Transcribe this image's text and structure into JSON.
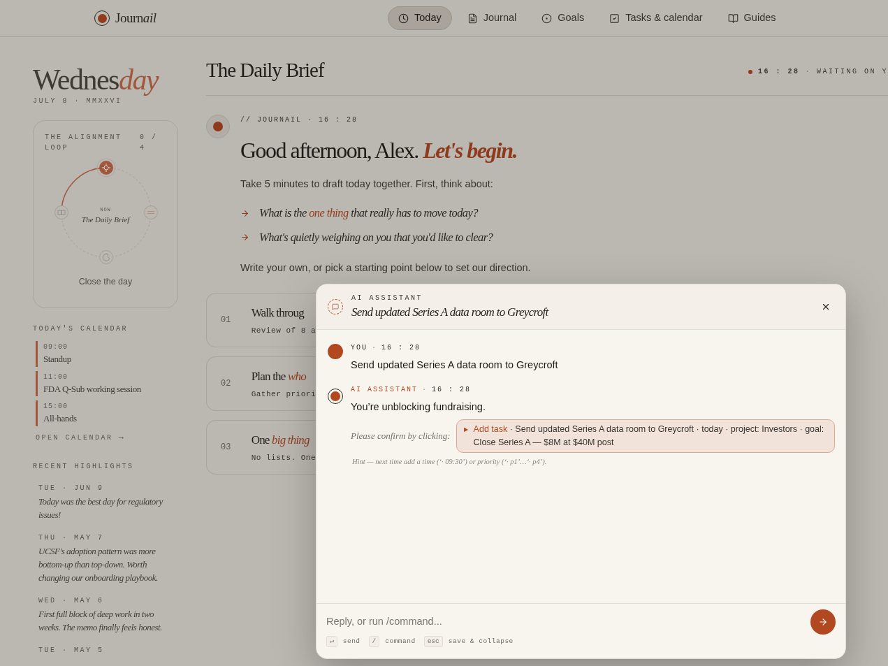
{
  "brand": {
    "name": [
      {
        "text": "Journ",
        "accent": false
      },
      {
        "text": "ail",
        "accent": true
      }
    ]
  },
  "nav": [
    {
      "label": "Today",
      "selected": true
    },
    {
      "label": "Journal",
      "selected": false
    },
    {
      "label": "Goals",
      "selected": false
    },
    {
      "label": "Tasks & calendar",
      "selected": false
    },
    {
      "label": "Guides",
      "selected": false
    }
  ],
  "sidebar": {
    "day": [
      {
        "text": "Wednes",
        "accent": false
      },
      {
        "text": "day",
        "accent": true
      }
    ],
    "date": "JULY 8 · MMXXVI",
    "loop": {
      "title": "THE ALIGNMENT LOOP",
      "count": "0 / 4",
      "level": 0.25,
      "now_label": "NOW",
      "now_step": "The Daily Brief",
      "next": "Close the day"
    },
    "calendar_heading": "TODAY'S CALENDAR",
    "calendar": [
      {
        "time": "09:00",
        "title": "Standup"
      },
      {
        "time": "11:00",
        "title": "FDA Q-Sub working session"
      },
      {
        "time": "15:00",
        "title": "All-hands"
      }
    ],
    "calendar_link": "OPEN CALENDAR ⟶",
    "highlights_heading": "RECENT HIGHLIGHTS",
    "highlights": [
      {
        "date": "TUE · JUN 9",
        "text": "Today was the best day for regulatory issues!"
      },
      {
        "date": "THU · MAY 7",
        "text": "UCSF's adoption pattern was more bottom-up than top-down. Worth changing our onboarding playbook."
      },
      {
        "date": "WED · MAY 6",
        "text": "First full block of deep work in two weeks. The memo finally feels honest."
      },
      {
        "date": "TUE · MAY 5"
      }
    ]
  },
  "main": {
    "title": "The Daily Brief",
    "status": {
      "time": "16 : 28",
      "sep": "·",
      "text": "WAITING ON Y"
    },
    "meta": "// JOURNAIL · 16 : 28",
    "greeting": [
      {
        "text": "Good afternoon, Alex. ",
        "accent": false
      },
      {
        "text": "Let's begin.",
        "accent": true
      }
    ],
    "intro": "Take 5 minutes to draft today together. First, think about:",
    "prompts": [
      [
        {
          "text": "What is the ",
          "accent": false
        },
        {
          "text": "one thing",
          "accent": true
        },
        {
          "text": " that really has to move today?",
          "accent": false
        }
      ],
      [
        {
          "text": "What's quietly weighing on you that you'd like to clear?",
          "accent": false
        }
      ]
    ],
    "outro": "Write your own, or pick a starting point below to set our direction.",
    "starters": [
      {
        "number": "01",
        "title": [
          {
            "text": "Walk throug",
            "accent": false
          }
        ],
        "subtitle": "Review of 8 a"
      },
      {
        "number": "02",
        "title": [
          {
            "text": "Plan the ",
            "accent": false
          },
          {
            "text": "who",
            "accent": true
          }
        ],
        "subtitle": "Gather priori"
      },
      {
        "number": "03",
        "title": [
          {
            "text": "One ",
            "accent": false
          },
          {
            "text": "big thing",
            "accent": true
          }
        ],
        "subtitle": "No lists. One"
      }
    ]
  },
  "assistant": {
    "label": "AI ASSISTANT",
    "title": "Send updated Series A data room to Greycroft",
    "messages": [
      {
        "kind": "user",
        "author": "YOU",
        "sep": "·",
        "time": "16 : 28",
        "text": "Send updated Series A data room to Greycroft"
      },
      {
        "kind": "assistant",
        "author": "AI ASSISTANT",
        "sep": "·",
        "time": "16 : 28",
        "text": "You’re unblocking fundraising."
      }
    ],
    "confirm_label": "Please confirm by clicking:",
    "action": {
      "marker": "▶",
      "verb": "Add task",
      "detail": " · Send updated Series A data room to Greycroft · today · project: Investors · goal: Close Series A — $8M at $40M post"
    },
    "hint": "Hint — next time add a time (‘· 09:30’) or priority (‘· p1’…‘· p4’).",
    "input": {
      "placeholder": "Reply, or run /command..."
    },
    "shortcuts": [
      {
        "key": "↵",
        "label": "send"
      },
      {
        "key": "/",
        "label": "command"
      },
      {
        "key": "esc",
        "label": "save & collapse"
      }
    ]
  }
}
